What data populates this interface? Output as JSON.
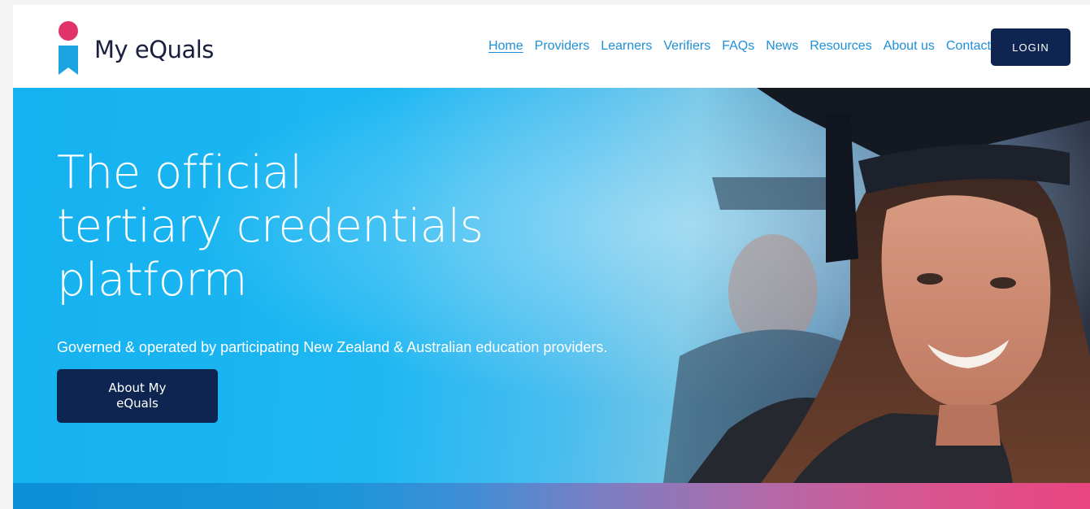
{
  "brand": {
    "name": "My eQuals"
  },
  "nav": {
    "items": [
      {
        "label": "Home",
        "active": true
      },
      {
        "label": "Providers"
      },
      {
        "label": "Learners"
      },
      {
        "label": "Verifiers"
      },
      {
        "label": "FAQs"
      },
      {
        "label": "News"
      },
      {
        "label": "Resources"
      },
      {
        "label": "About us"
      },
      {
        "label": "Contact"
      }
    ],
    "login_label": "LOGIN"
  },
  "hero": {
    "title_lines": [
      "The official",
      "tertiary credentials",
      "platform"
    ],
    "subtitle": "Governed & operated by participating New Zealand & Australian education providers.",
    "cta_label": "About My eQuals",
    "image": "graduate-smiling-photo"
  },
  "colors": {
    "nav_link": "#1e8fd9",
    "button_navy": "#0d2550",
    "logo_pink": "#e0336a",
    "logo_blue": "#1aa3e0",
    "hero_blue": "#1eb7f2",
    "strip_start": "#0c8fd8",
    "strip_end": "#ea4680"
  }
}
